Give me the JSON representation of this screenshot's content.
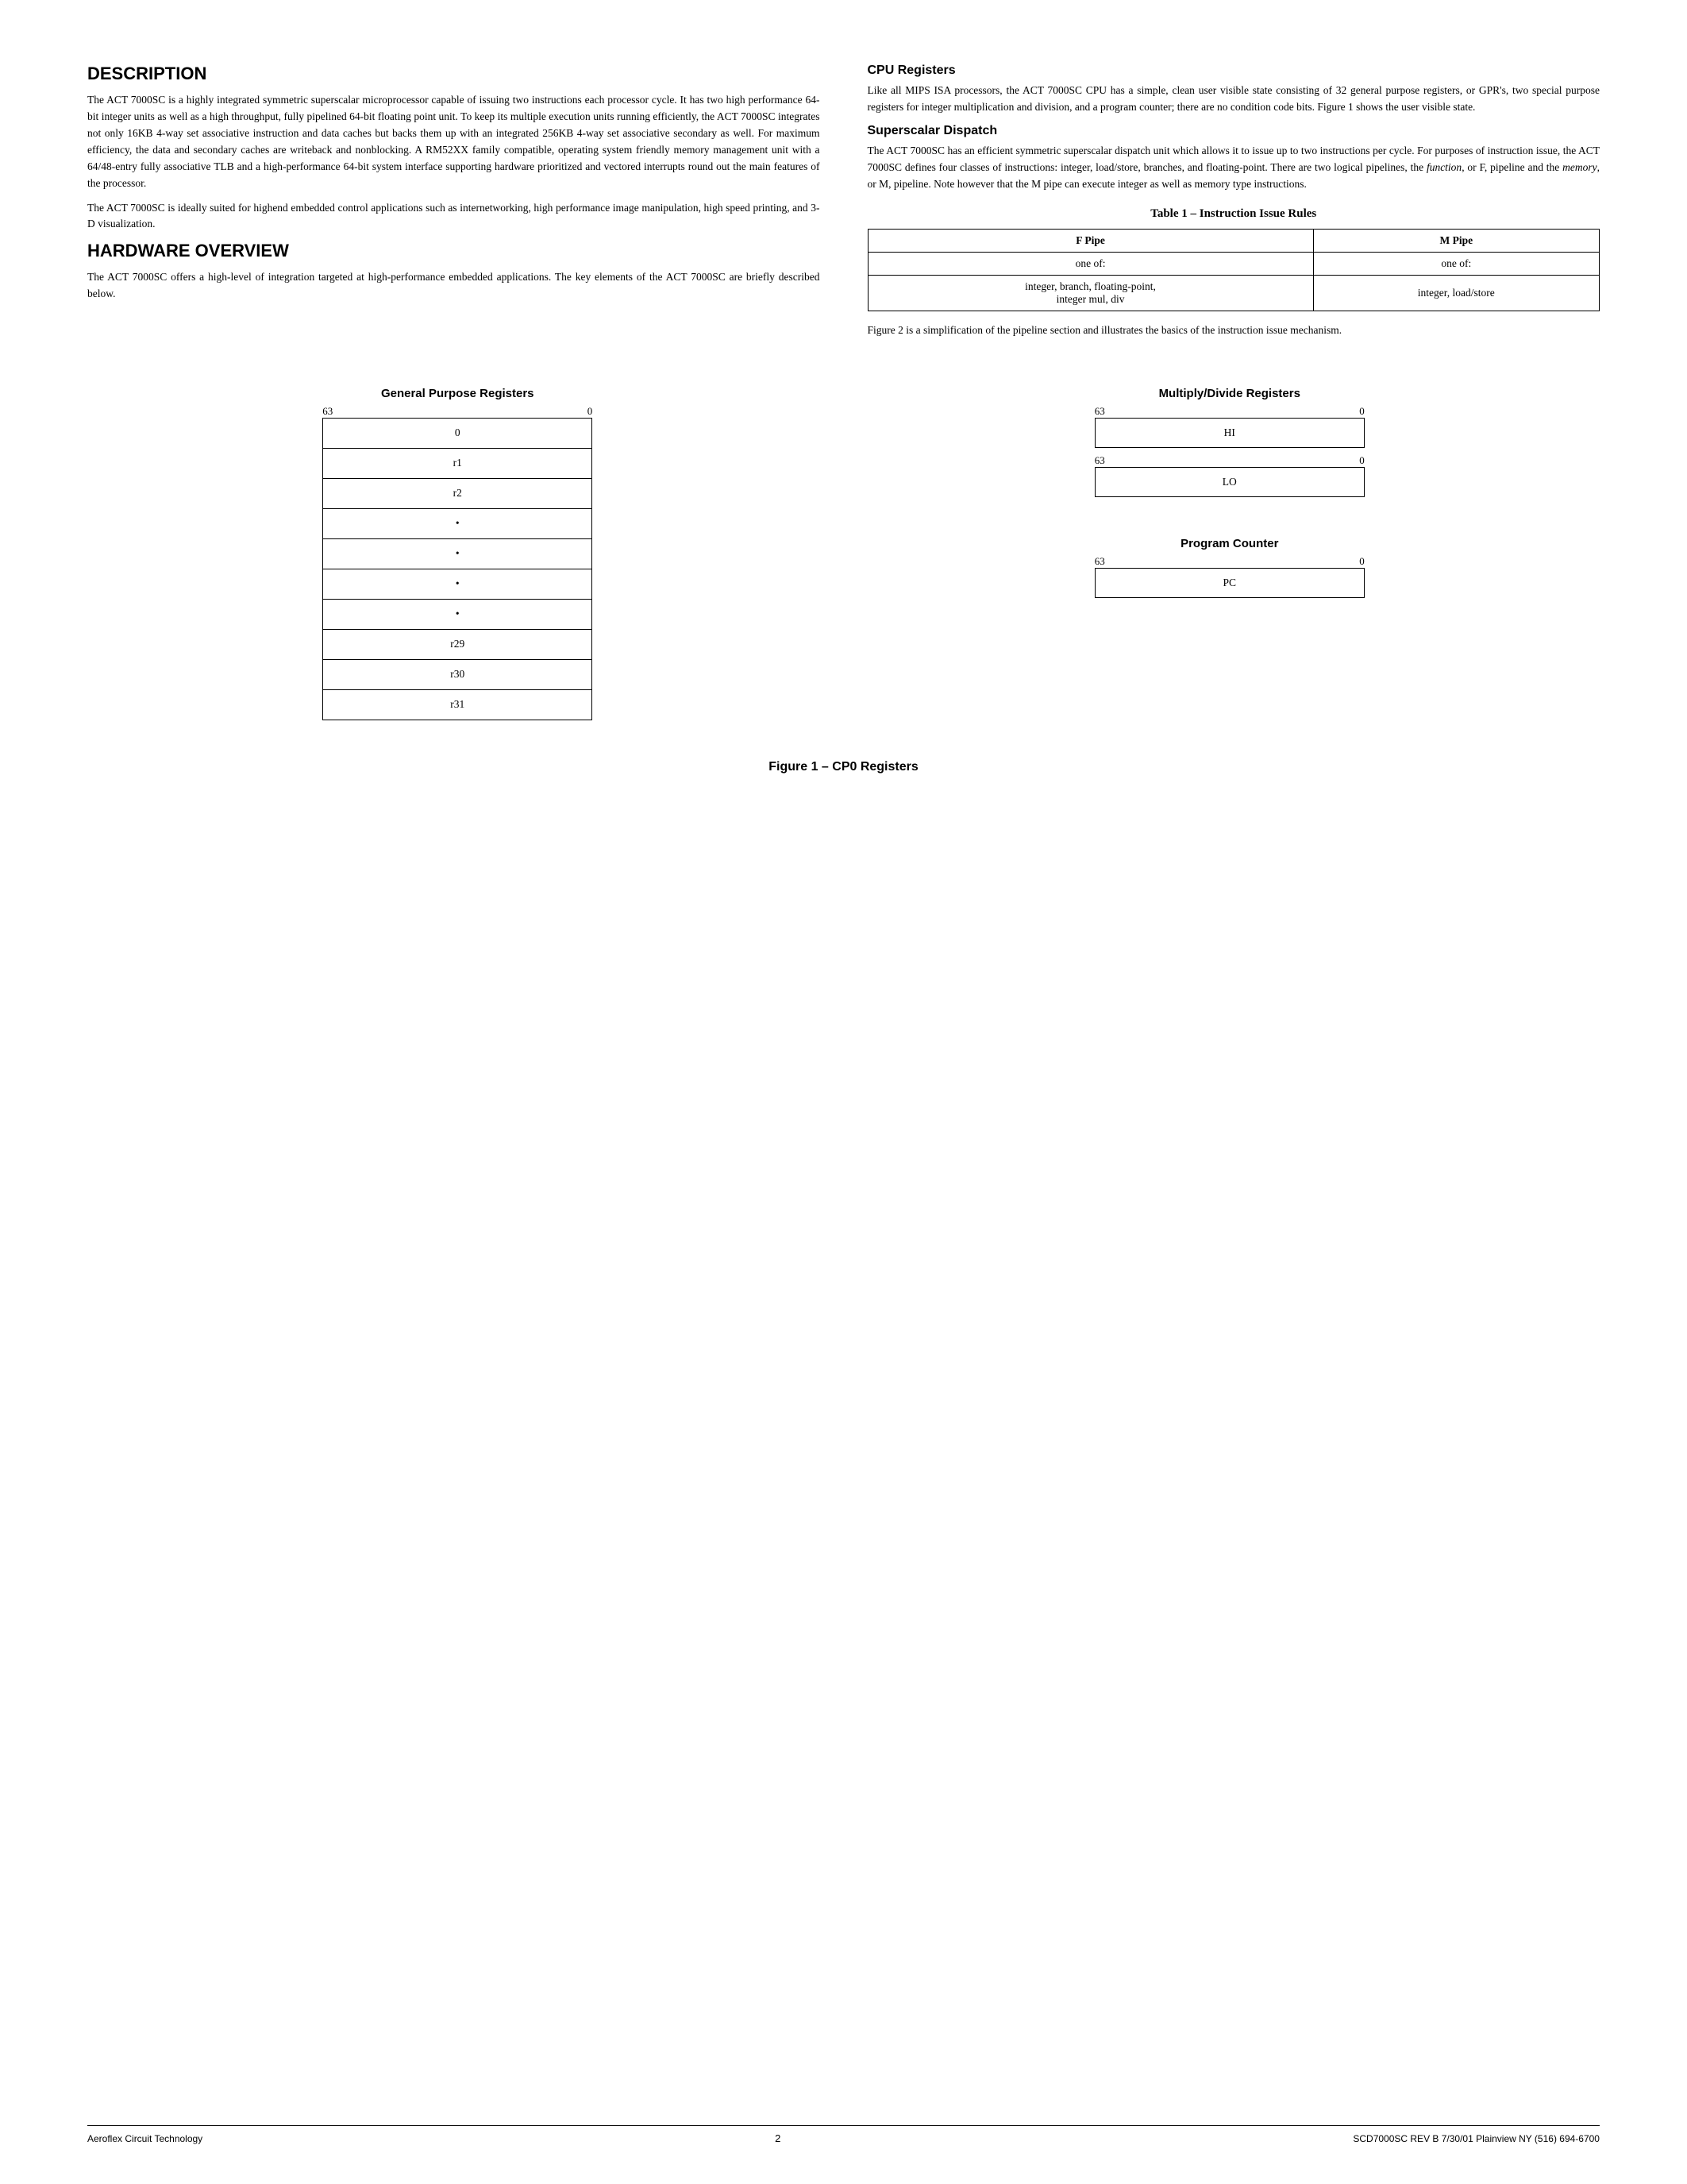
{
  "page": {
    "sections": {
      "description": {
        "title": "DESCRIPTION",
        "paragraphs": [
          "The ACT 7000SC is a highly integrated symmetric superscalar microprocessor capable of issuing two instructions each processor cycle. It has two high performance 64-bit integer units as well as a high throughput, fully pipelined 64-bit floating point unit. To keep its multiple execution units running efficiently, the ACT 7000SC integrates not only 16KB 4-way set associative instruction and data caches but backs them up with an integrated 256KB 4-way set associative secondary as well. For maximum efficiency, the data and secondary caches are writeback and nonblocking. A RM52XX family compatible, operating system friendly memory management unit with a 64/48-entry fully associative TLB and a high-performance 64-bit system interface supporting hardware prioritized and vectored interrupts round out the main features of the processor.",
          "The ACT 7000SC is ideally suited for highend embedded control applications such as internetworking, high performance image manipulation, high speed printing, and 3-D visualization."
        ]
      },
      "hardware_overview": {
        "title": "HARDWARE OVERVIEW",
        "paragraphs": [
          "The ACT 7000SC offers a high-level of integration targeted at high-performance embedded applications. The key elements of the ACT 7000SC are briefly described below."
        ]
      },
      "cpu_registers": {
        "title": "CPU Registers",
        "paragraphs": [
          "Like all MIPS ISA processors, the ACT 7000SC CPU has a simple, clean user visible state consisting of 32 general purpose registers, or GPR's, two special purpose registers for integer multiplication and division, and a program counter; there are no condition code bits. Figure 1 shows the user visible state."
        ]
      },
      "superscalar_dispatch": {
        "title": "Superscalar Dispatch",
        "paragraphs": [
          "The ACT 7000SC has an efficient symmetric superscalar dispatch unit which allows it to issue up to two instructions per cycle. For purposes of instruction issue, the ACT 7000SC defines four classes of instructions: integer, load/store, branches, and floating-point. There are two logical pipelines, the function, or F, pipeline and the memory, or M, pipeline. Note however that the M pipe can execute integer as well as memory type instructions."
        ]
      },
      "instruction_issue_table": {
        "title": "Table 1 – Instruction Issue Rules",
        "headers": [
          "F Pipe",
          "M Pipe"
        ],
        "rows": [
          [
            "one of:",
            "one of:"
          ],
          [
            "integer, branch, floating-point,\ninteger mul, div",
            "integer, load/store"
          ]
        ]
      },
      "figure_note": "Figure 2 is a simplification of the pipeline section and illustrates the basics of the instruction issue mechanism."
    },
    "diagrams": {
      "gpr": {
        "title": "General Purpose Registers",
        "bit_high": "63",
        "bit_low": "0",
        "rows": [
          "0",
          "r1",
          "r2",
          "•",
          "•",
          "•",
          "•",
          "r29",
          "r30",
          "r31"
        ]
      },
      "multiply_divide": {
        "title": "Multiply/Divide Registers",
        "bit_high": "63",
        "bit_low": "0",
        "registers": [
          "HI",
          "LO"
        ]
      },
      "program_counter": {
        "title": "Program Counter",
        "bit_high": "63",
        "bit_low": "0",
        "register": "PC"
      }
    },
    "figure_caption": "Figure 1 – CP0 Registers",
    "footer": {
      "left": "Aeroflex Circuit Technology",
      "center": "2",
      "right": "SCD7000SC REV B  7/30/01  Plainview NY (516) 694-6700"
    }
  }
}
